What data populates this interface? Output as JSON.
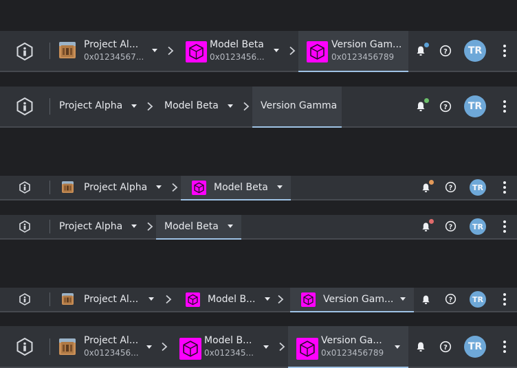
{
  "bars": [
    {
      "project": {
        "name": "Project Al...",
        "id": "0x01234567..."
      },
      "model": {
        "name": "Model Beta",
        "id": "0x0123456..."
      },
      "version": {
        "name": "Version Gam...",
        "id": "0x0123456789"
      },
      "dot_color": "#5aa0d6",
      "avatar_initials": "TR"
    },
    {
      "project": {
        "name": "Project Alpha"
      },
      "model": {
        "name": "Model Beta"
      },
      "version": {
        "name": "Version Gamma"
      },
      "dot_color": "#6cbf6a",
      "avatar_initials": "TR"
    },
    {
      "project": {
        "name": "Project Alpha"
      },
      "model": {
        "name": "Model Beta"
      },
      "dot_color": "#e39a5a",
      "avatar_initials": "TR"
    },
    {
      "project": {
        "name": "Project Alpha"
      },
      "model": {
        "name": "Model Beta"
      },
      "dot_color": "#e06b6b",
      "avatar_initials": "TR"
    },
    {
      "project": {
        "name": "Project Al..."
      },
      "model": {
        "name": "Model B..."
      },
      "version": {
        "name": "Version Gam..."
      },
      "avatar_initials": "TR"
    },
    {
      "project": {
        "name": "Project Al...",
        "id": "0x0123456..."
      },
      "model": {
        "name": "Model B...",
        "id": "0x012345..."
      },
      "version": {
        "name": "Version Ga...",
        "id": "0x0123456789"
      },
      "avatar_initials": "TR"
    }
  ],
  "icons": {
    "app_logo": "info-logo-icon",
    "project_thumb": "building-photo",
    "model_thumb": "magenta-cube-icon",
    "breadcrumb_separator": "chevron-right-icon",
    "dropdown": "caret-down-icon",
    "notifications": "bell-icon",
    "help": "help-icon",
    "more": "kebab-icon"
  },
  "colors": {
    "page_bg": "#1f2023",
    "bar_bg": "#303338",
    "selected_bg": "#3b3f45",
    "selected_underline": "#9fc3e6",
    "avatar": "#6ea8d8",
    "model_thumb": "#ff00ff"
  }
}
